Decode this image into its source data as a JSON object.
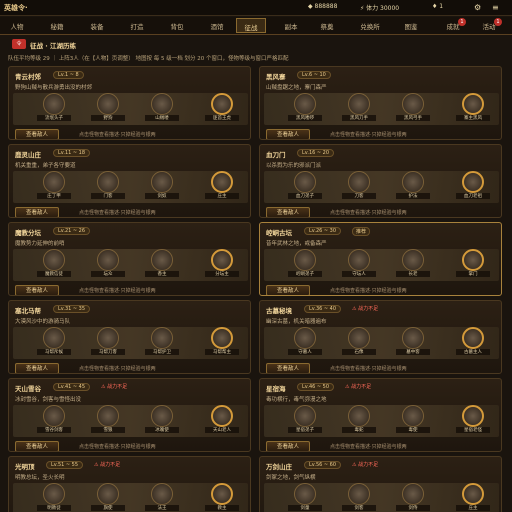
{
  "topbar": {
    "logo": "英雄令·",
    "gold": "888888",
    "stamina": "体力 30000",
    "gems": "1"
  },
  "nav": {
    "tabs": [
      "人物",
      "秘籍",
      "装备",
      "打造",
      "背包",
      "酒馆",
      "征战",
      "副本",
      "祭奠",
      "兑换所",
      "图鉴",
      "成就",
      "活动"
    ],
    "active_index": 6,
    "badges": {
      "12": "1",
      "11": "1"
    }
  },
  "header": {
    "icon": "令",
    "title": "征战 · 江湖历练"
  },
  "subinfo": "队伍平均等级 29 ｜ 上阵3人（在【人物】页调整） 地图按 每 5 级一档 划分 20 个窗口，怪物等级与窗口严格匹配",
  "cards": [
    {
      "name": "青云村郊",
      "level": "Lv.1 ~ 8",
      "tag": "",
      "desc": "野狗山贼与散兵游勇出没的村郊",
      "heroes": [
        "流氓头子",
        "野狗",
        "山贼喽",
        "匪首王虎"
      ],
      "action": "查看敌人",
      "hint": "点击怪物查看描述·只掉经验与银两"
    },
    {
      "name": "黑风寨",
      "level": "Lv.6 ~ 10",
      "tag": "",
      "desc": "山贼盘踞之地，寨门森严",
      "heroes": [
        "黑风喽啰",
        "黑风刀手",
        "黑风弓手",
        "寨主黑风"
      ],
      "action": "查看敌人",
      "hint": "点击怪物查看描述·只掉经验与银两"
    },
    {
      "name": "鹿灵山庄",
      "level": "Lv.11 ~ 18",
      "tag": "",
      "desc": "机关重重，弟子各守要道",
      "heroes": [
        "庄丁甲",
        "门客",
        "剑奴",
        "庄主"
      ],
      "action": "查看敌人",
      "hint": "点击怪物查看描述·只掉经验与银两"
    },
    {
      "name": "血刀门",
      "level": "Lv.16 ~ 20",
      "tag": "",
      "desc": "以杀戮为乐的邪派门派",
      "heroes": [
        "血刀弟子",
        "刀客",
        "护法",
        "血刀老祖"
      ],
      "action": "查看敌人",
      "hint": "点击怪物查看描述·只掉经验与银两"
    },
    {
      "name": "魔教分坛",
      "level": "Lv.21 ~ 26",
      "tag": "",
      "desc": "魔教势力延伸的前哨",
      "heroes": [
        "魔教信徒",
        "坛众",
        "香主",
        "分坛主"
      ],
      "action": "查看敌人",
      "hint": "点击怪物查看描述·只掉经验与银两"
    },
    {
      "name": "崆峒古坛",
      "level": "Lv.26 ~ 30",
      "tag": "推荐",
      "desc": "昔年武林之地，戒备森严",
      "heroes": [
        "崆峒弟子",
        "守坛人",
        "长老",
        "掌门"
      ],
      "action": "查看敌人",
      "hint": "点击怪物查看描述·只掉经验与银两"
    },
    {
      "name": "塞北马帮",
      "level": "Lv.31 ~ 35",
      "tag": "",
      "desc": "大漠风沙中的游骑马队",
      "heroes": [
        "马帮斥候",
        "马帮刀客",
        "马帮护卫",
        "马帮帮主"
      ],
      "action": "查看敌人",
      "hint": "点击怪物查看描述·只掉经验与银两"
    },
    {
      "name": "古墓秘境",
      "level": "Lv.36 ~ 40",
      "tag": "战力不足",
      "desc": "幽深古墓，机关暗器遍布",
      "heroes": [
        "守墓人",
        "石像",
        "墓中客",
        "古墓主人"
      ],
      "action": "查看敌人",
      "hint": "点击怪物查看描述·只掉经验与银两"
    },
    {
      "name": "天山雪谷",
      "level": "Lv.41 ~ 45",
      "tag": "战力不足",
      "desc": "冰封雪谷，剑客与雪怪出没",
      "heroes": [
        "雪谷剑客",
        "雪狼",
        "冰魄使",
        "天山老人"
      ],
      "action": "查看敌人",
      "hint": "点击怪物查看描述·只掉经验与银两"
    },
    {
      "name": "星宿海",
      "level": "Lv.46 ~ 50",
      "tag": "战力不足",
      "desc": "毒功横行，毒气弥漫之地",
      "heroes": [
        "星宿弟子",
        "毒蛇",
        "毒使",
        "星宿老怪"
      ],
      "action": "查看敌人",
      "hint": "点击怪物查看描述·只掉经验与银两"
    },
    {
      "name": "光明顶",
      "level": "Lv.51 ~ 55",
      "tag": "战力不足",
      "desc": "明教总坛，圣火长明",
      "heroes": [
        "明教徒",
        "旗使",
        "法王",
        "教主"
      ],
      "action": "查看敌人",
      "hint": "点击怪物查看描述·只掉经验与银两"
    },
    {
      "name": "万剑山庄",
      "level": "Lv.56 ~ 60",
      "tag": "战力不足",
      "desc": "剑冢之地，剑气纵横",
      "heroes": [
        "剑童",
        "剑客",
        "剑侍",
        "庄主"
      ],
      "action": "查看敌人",
      "hint": "点击怪物查看描述·只掉经验与银两"
    }
  ]
}
